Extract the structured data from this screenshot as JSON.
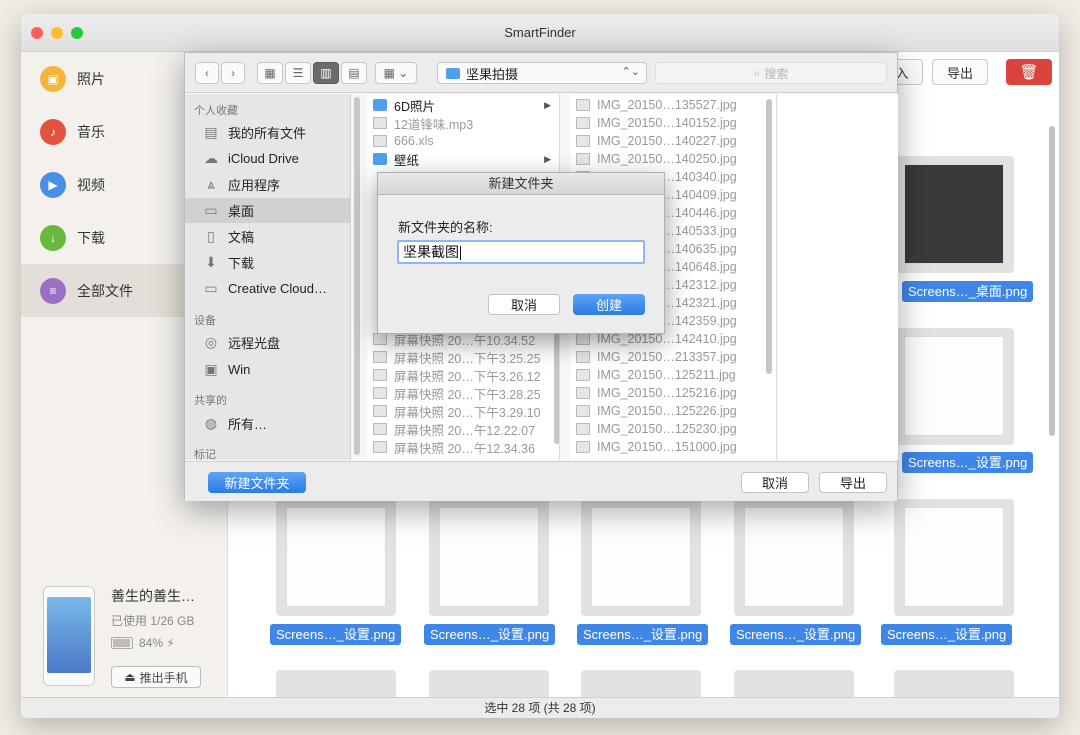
{
  "window": {
    "title": "SmartFinder"
  },
  "sidebar": {
    "items": [
      {
        "label": "照片",
        "icon": "photo-icon",
        "color": "#f5b53b"
      },
      {
        "label": "音乐",
        "icon": "music-icon",
        "color": "#e2523c"
      },
      {
        "label": "视频",
        "icon": "video-icon",
        "color": "#4a8fe6"
      },
      {
        "label": "下载",
        "icon": "download-icon",
        "color": "#6ab83e"
      },
      {
        "label": "全部文件",
        "icon": "all-files-icon",
        "color": "#9a6fc6"
      }
    ]
  },
  "device": {
    "name": "善生的善生…",
    "usage": "已使用 1/26 GB",
    "battery": "84%",
    "eject_label": "推出手机"
  },
  "toolbar": {
    "import_label": "入",
    "export_label": "导出"
  },
  "thumbs": {
    "labels": [
      "Screens…_桌面.png",
      "Screens…_设置.png",
      "Screens…_设置.png",
      "Screens…_设置.png",
      "Screens…_设置.png",
      "Screens…_设置.png",
      "Screens…_设置.png"
    ]
  },
  "status": {
    "text": "选中 28 项 (共 28 项)"
  },
  "save_panel": {
    "path": "坚果拍摄",
    "search_placeholder": "搜索",
    "sidebar": {
      "favorites_title": "个人收藏",
      "favorites": [
        "我的所有文件",
        "iCloud Drive",
        "应用程序",
        "桌面",
        "文稿",
        "下载",
        "Creative Cloud…"
      ],
      "devices_title": "设备",
      "devices": [
        "远程光盘",
        "Win"
      ],
      "shared_title": "共享的",
      "shared": [
        "所有…"
      ],
      "tags_title": "标记"
    },
    "col1_top": [
      "6D照片",
      "12道锋味.mp3",
      "666.xls",
      "壁纸"
    ],
    "col1_bottom": [
      "屏幕快照 20…午10.34.52",
      "屏幕快照 20…下午3.25.25",
      "屏幕快照 20…下午3.26.12",
      "屏幕快照 20…下午3.28.25",
      "屏幕快照 20…下午3.29.10",
      "屏幕快照 20…午12.22.07",
      "屏幕快照 20…午12.34.36"
    ],
    "col2": [
      "IMG_20150…135527.jpg",
      "IMG_20150…140152.jpg",
      "IMG_20150…140227.jpg",
      "IMG_20150…140250.jpg",
      "IMG_20150…140340.jpg",
      "IMG_20150…140409.jpg",
      "IMG_20150…140446.jpg",
      "IMG_20150…140533.jpg",
      "IMG_20150…140635.jpg",
      "IMG_20150…140648.jpg",
      "IMG_20150…142312.jpg",
      "IMG_20150…142321.jpg",
      "IMG_20150…142359.jpg",
      "IMG_20150…142410.jpg",
      "IMG_20150…213357.jpg",
      "IMG_20150…125211.jpg",
      "IMG_20150…125216.jpg",
      "IMG_20150…125226.jpg",
      "IMG_20150…125230.jpg",
      "IMG_20150…151000.jpg"
    ],
    "new_folder_label": "新建文件夹",
    "cancel_label": "取消",
    "export_label": "导出"
  },
  "dialog": {
    "title": "新建文件夹",
    "prompt": "新文件夹的名称:",
    "value": "坚果截图",
    "cancel_label": "取消",
    "create_label": "创建"
  }
}
